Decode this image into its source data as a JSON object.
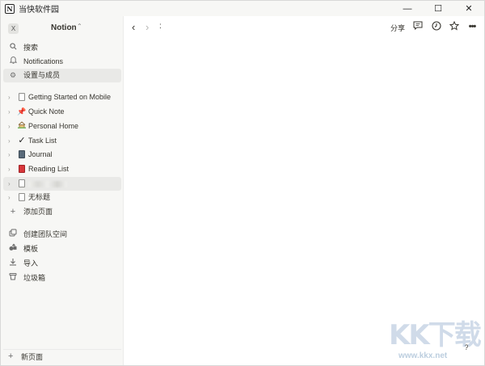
{
  "titlebar": {
    "app_icon_glyph": "N",
    "title": "当快软件园",
    "minimize": "—",
    "maximize": "☐",
    "close": "✕"
  },
  "sidebar": {
    "workspace": {
      "avatar": "X",
      "name": "Notion",
      "chevron": "⌃⌄"
    },
    "top_items": [
      {
        "icon": "search-icon",
        "label": "搜索"
      },
      {
        "icon": "bell-icon",
        "label": "Notifications"
      },
      {
        "icon": "gear-icon",
        "label": "设置与成员"
      }
    ],
    "pages": [
      {
        "icon": "doc-icon",
        "label": "Getting Started on Mobile"
      },
      {
        "icon": "pushpin-icon",
        "glyph": "📌",
        "label": "Quick Note"
      },
      {
        "icon": "house-icon",
        "glyph": "🏡",
        "label": "Personal Home"
      },
      {
        "icon": "checkmark-icon",
        "glyph": "✓",
        "label": "Task List"
      },
      {
        "icon": "notebook-icon",
        "label": "Journal"
      },
      {
        "icon": "red-book-icon",
        "label": "Reading List"
      },
      {
        "icon": "doc-icon",
        "label": ""
      },
      {
        "icon": "doc-icon",
        "label": "无标题"
      }
    ],
    "add_page": "添加页面",
    "bottom_items": [
      {
        "icon": "team-icon",
        "label": "创建团队空间"
      },
      {
        "icon": "shapes-icon",
        "label": "模板"
      },
      {
        "icon": "import-icon",
        "label": "导入"
      },
      {
        "icon": "trash-icon",
        "label": "垃圾箱"
      }
    ],
    "new_page": "新页面"
  },
  "main": {
    "breadcrumb": ":",
    "share_label": "分享",
    "help": "?"
  },
  "watermark": {
    "brand": "KK下载",
    "url": "www.kkx.net"
  },
  "colors": {
    "sidebar_bg": "#f7f7f5",
    "active_item_bg": "#e9e9e7",
    "text": "#37352f"
  }
}
